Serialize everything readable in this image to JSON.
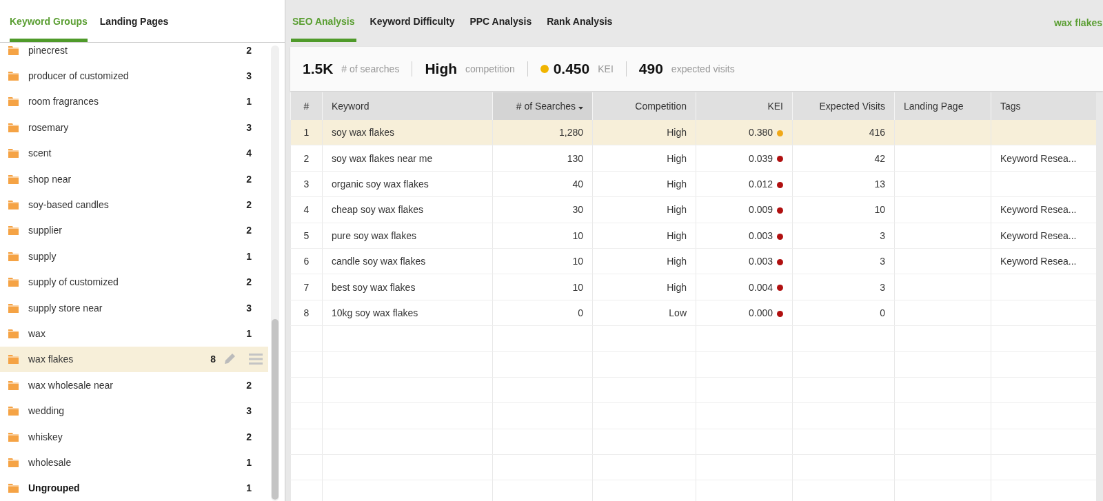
{
  "sidebar": {
    "tabs": [
      {
        "label": "Keyword Groups",
        "selected": true
      },
      {
        "label": "Landing Pages",
        "selected": false
      }
    ],
    "groups": [
      {
        "name": "pinecrest",
        "count": "2",
        "selected": false,
        "kind": "group"
      },
      {
        "name": "producer of customized",
        "count": "3",
        "selected": false,
        "kind": "group"
      },
      {
        "name": "room fragrances",
        "count": "1",
        "selected": false,
        "kind": "group"
      },
      {
        "name": "rosemary",
        "count": "3",
        "selected": false,
        "kind": "group"
      },
      {
        "name": "scent",
        "count": "4",
        "selected": false,
        "kind": "group"
      },
      {
        "name": "shop near",
        "count": "2",
        "selected": false,
        "kind": "group"
      },
      {
        "name": "soy-based candles",
        "count": "2",
        "selected": false,
        "kind": "group"
      },
      {
        "name": "supplier",
        "count": "2",
        "selected": false,
        "kind": "group"
      },
      {
        "name": "supply",
        "count": "1",
        "selected": false,
        "kind": "group"
      },
      {
        "name": "supply of customized",
        "count": "2",
        "selected": false,
        "kind": "group"
      },
      {
        "name": "supply store near",
        "count": "3",
        "selected": false,
        "kind": "group"
      },
      {
        "name": "wax",
        "count": "1",
        "selected": false,
        "kind": "group"
      },
      {
        "name": "wax flakes",
        "count": "8",
        "selected": true,
        "kind": "group"
      },
      {
        "name": "wax wholesale near",
        "count": "2",
        "selected": false,
        "kind": "group"
      },
      {
        "name": "wedding",
        "count": "3",
        "selected": false,
        "kind": "group"
      },
      {
        "name": "whiskey",
        "count": "2",
        "selected": false,
        "kind": "group"
      },
      {
        "name": "wholesale",
        "count": "1",
        "selected": false,
        "kind": "group"
      },
      {
        "name": "Ungrouped",
        "count": "1",
        "selected": false,
        "kind": "ungrouped"
      }
    ]
  },
  "main": {
    "tabs": [
      {
        "label": "SEO Analysis",
        "selected": true
      },
      {
        "label": "Keyword Difficulty",
        "selected": false
      },
      {
        "label": "PPC Analysis",
        "selected": false
      },
      {
        "label": "Rank Analysis",
        "selected": false
      }
    ],
    "group_name": "wax flakes",
    "summary": [
      {
        "value": "1.5K",
        "label": "# of searches"
      },
      {
        "value": "High",
        "label": "competition"
      },
      {
        "value": "0.450",
        "label": "KEI",
        "color": "#f0b400"
      },
      {
        "value": "490",
        "label": "expected visits"
      }
    ],
    "table": {
      "columns": [
        {
          "label": "#",
          "sorted": false
        },
        {
          "label": "Keyword",
          "sorted": false
        },
        {
          "label": "# of Searches",
          "sorted": true
        },
        {
          "label": "Competition",
          "sorted": false
        },
        {
          "label": "KEI",
          "sorted": false
        },
        {
          "label": "Expected Visits",
          "sorted": false
        },
        {
          "label": "Landing Page",
          "sorted": false
        },
        {
          "label": "Tags",
          "sorted": false
        }
      ],
      "rows": [
        {
          "num": "1",
          "keyword": "soy wax flakes",
          "searches": "1,280",
          "competition": "High",
          "kei": "0.380",
          "color": "#f0a818",
          "visits": "416",
          "selected": true
        },
        {
          "num": "2",
          "keyword": "soy wax flakes near me",
          "searches": "130",
          "competition": "High",
          "kei": "0.039",
          "color": "#b01010",
          "visits": "42",
          "tags": "Keyword Resea...",
          "selected": false
        },
        {
          "num": "3",
          "keyword": "organic soy wax flakes",
          "searches": "40",
          "competition": "High",
          "kei": "0.012",
          "color": "#b01010",
          "visits": "13",
          "selected": false
        },
        {
          "num": "4",
          "keyword": "cheap soy wax flakes",
          "searches": "30",
          "competition": "High",
          "kei": "0.009",
          "color": "#b01010",
          "visits": "10",
          "tags": "Keyword Resea...",
          "selected": false
        },
        {
          "num": "5",
          "keyword": "pure soy wax flakes",
          "searches": "10",
          "competition": "High",
          "kei": "0.003",
          "color": "#b01010",
          "visits": "3",
          "tags": "Keyword Resea...",
          "selected": false
        },
        {
          "num": "6",
          "keyword": "candle soy wax flakes",
          "searches": "10",
          "competition": "High",
          "kei": "0.003",
          "color": "#b01010",
          "visits": "3",
          "tags": "Keyword Resea...",
          "selected": false
        },
        {
          "num": "7",
          "keyword": "best soy wax flakes",
          "searches": "10",
          "competition": "High",
          "kei": "0.004",
          "color": "#b01010",
          "visits": "3",
          "selected": false
        },
        {
          "num": "8",
          "keyword": "10kg soy wax flakes",
          "searches": "0",
          "competition": "Low",
          "kei": "0.000",
          "color": "#b01010",
          "visits": "0",
          "selected": false
        }
      ]
    }
  }
}
